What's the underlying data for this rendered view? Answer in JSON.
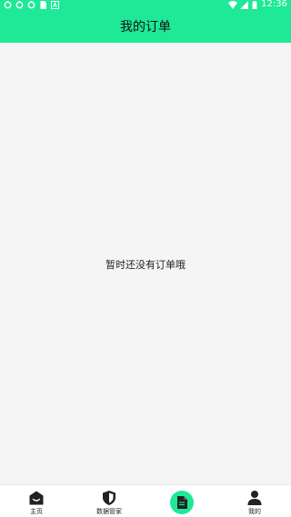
{
  "status_bar": {
    "time": "12:36",
    "left_icons": [
      "sync-icon",
      "sync-icon",
      "sync-icon",
      "sim-card-icon",
      "a-notification-icon"
    ],
    "right_icons": [
      "wifi-icon",
      "signal-icon",
      "battery-icon"
    ]
  },
  "header": {
    "title": "我的订单"
  },
  "main": {
    "empty_message": "暂时还没有订单哦"
  },
  "bottom_nav": {
    "items": [
      {
        "label": "主页",
        "icon": "home-icon",
        "active": false
      },
      {
        "label": "数据管家",
        "icon": "shield-icon",
        "active": false
      },
      {
        "label": "",
        "icon": "document-icon",
        "active": true
      },
      {
        "label": "我的",
        "icon": "person-icon",
        "active": false
      }
    ]
  },
  "colors": {
    "accent": "#1de996",
    "background": "#f5f5f5",
    "nav_background": "#ffffff"
  }
}
